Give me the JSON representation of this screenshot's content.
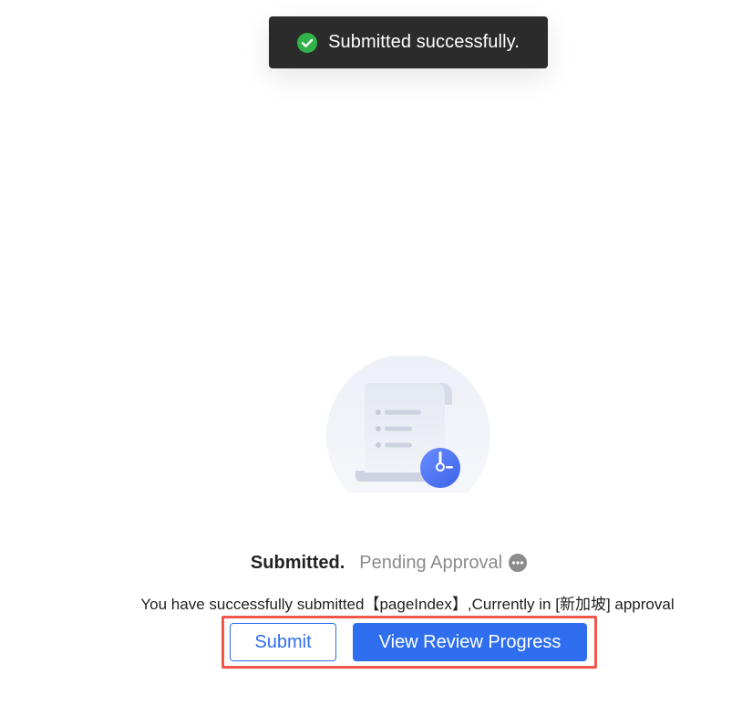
{
  "toast": {
    "icon": "check-circle-icon",
    "message": "Submitted successfully.",
    "icon_color": "#32b34a"
  },
  "illustration": {
    "icon": "document-clock-icon"
  },
  "status": {
    "title": "Submitted.",
    "pending": "Pending Approval",
    "pending_icon": "more-icon"
  },
  "message": "You have successfully submitted【pageIndex】,Currently in [新加坡] approval",
  "actions": {
    "submit_label": "Submit",
    "progress_label": "View Review Progress",
    "primary_color": "#2f6fef",
    "highlight_color": "#f0564a"
  }
}
